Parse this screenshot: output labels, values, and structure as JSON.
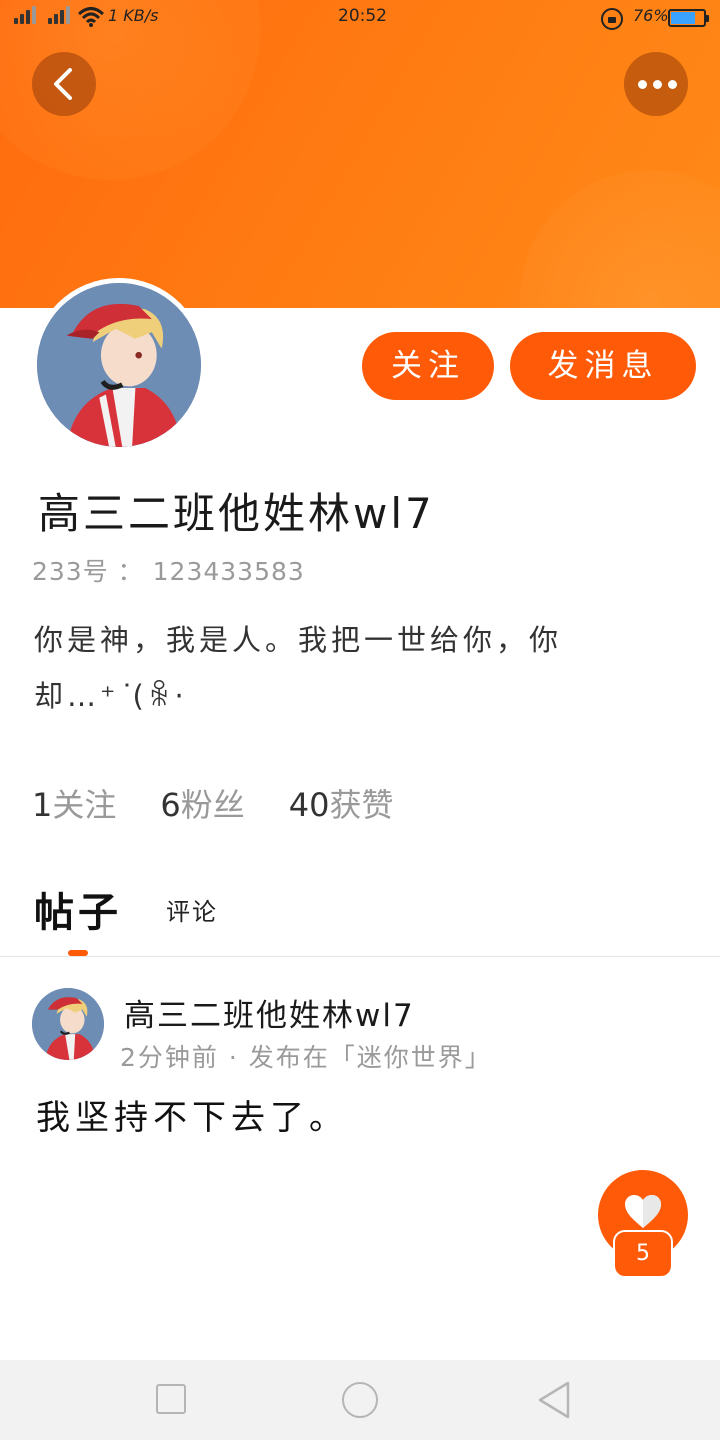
{
  "status_bar": {
    "net_speed": "1 KB/s",
    "time": "20:52",
    "battery_percent": "76%",
    "battery_level": 0.76
  },
  "header": {
    "back_icon": "chevron-left-icon",
    "more_icon": "more-dots-icon"
  },
  "profile": {
    "username": "高三二班他姓林wl7",
    "id_label": "233号",
    "id_separator": "：",
    "id_value": "123433583",
    "bio_line1": "你是神，我是人。我把一世给你，你",
    "bio_line2": "却…⁺ ͘(ꆜ·",
    "follow_label": "关注",
    "message_label": "发消息"
  },
  "stats": [
    {
      "num": "1",
      "label": "关注"
    },
    {
      "num": "6",
      "label": "粉丝"
    },
    {
      "num": "40",
      "label": "获赞"
    }
  ],
  "tabs": [
    {
      "label": "帖子",
      "active": true
    },
    {
      "label": "评论",
      "active": false
    }
  ],
  "post": {
    "author": "高三二班他姓林wl7",
    "meta": "2分钟前 · 发布在「迷你世界」",
    "text": "我坚持不下去了。",
    "like_count": "5"
  },
  "colors": {
    "accent": "#ff5a08",
    "banner": "#ff7a12"
  }
}
